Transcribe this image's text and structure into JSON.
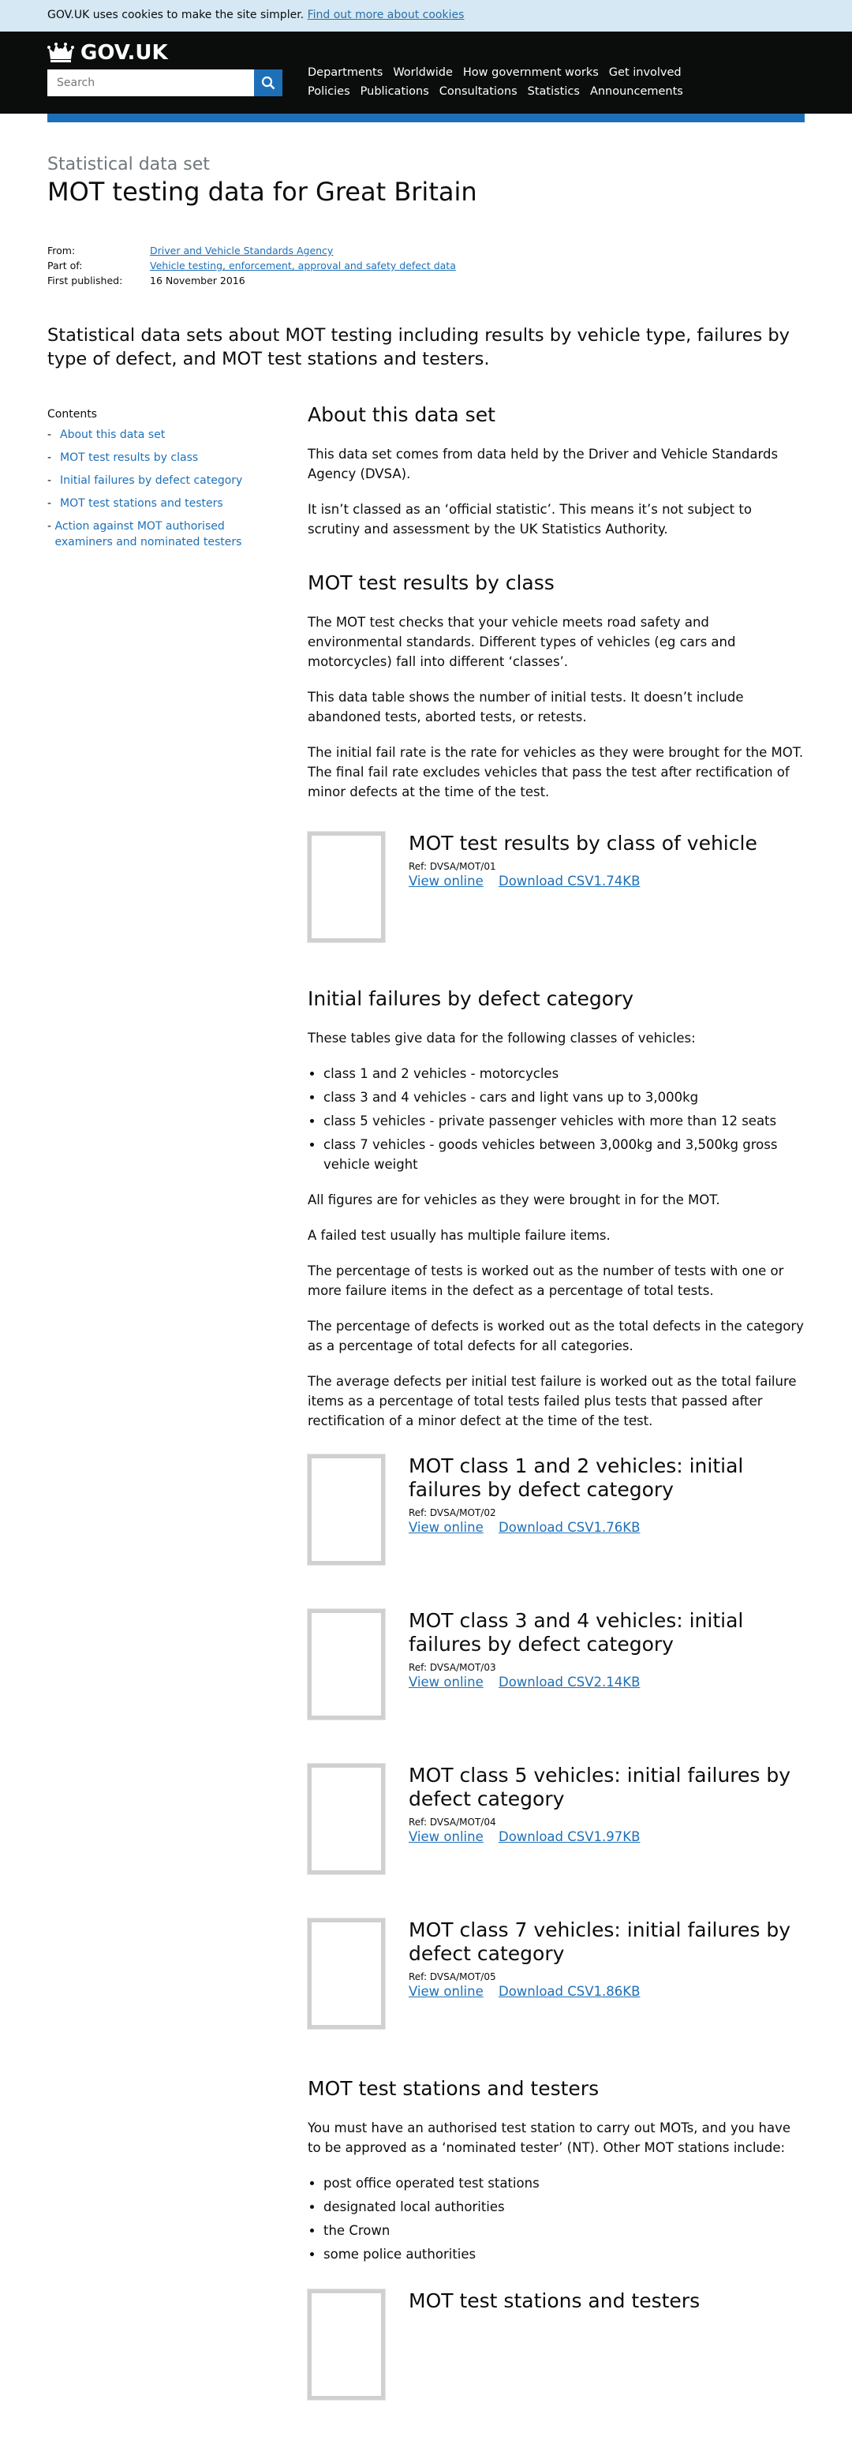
{
  "cookie_banner": {
    "text": "GOV.UK uses cookies to make the site simpler.",
    "link": "Find out more about cookies"
  },
  "header": {
    "logo": "GOV.UK",
    "search_placeholder": "Search",
    "nav_row1": [
      "Departments",
      "Worldwide",
      "How government works",
      "Get involved"
    ],
    "nav_row2": [
      "Policies",
      "Publications",
      "Consultations",
      "Statistics",
      "Announcements"
    ]
  },
  "page": {
    "doc_type": "Statistical data set",
    "title": "MOT testing data for Great Britain",
    "meta": {
      "from_label": "From:",
      "from_value": "Driver and Vehicle Standards Agency",
      "partof_label": "Part of:",
      "partof_value": "Vehicle testing, enforcement, approval and safety defect data",
      "published_label": "First published:",
      "published_value": "16 November 2016"
    },
    "summary": "Statistical data sets about MOT testing including results by vehicle type, failures by type of defect, and MOT test stations and testers."
  },
  "contents": {
    "title": "Contents",
    "items": [
      "About this data set",
      "MOT test results by class",
      "Initial failures by defect category",
      "MOT test stations and testers",
      "Action against MOT authorised examiners and nominated testers"
    ]
  },
  "sections": {
    "about": {
      "heading": "About this data set",
      "p1": "This data set comes from data held by the Driver and Vehicle Standards Agency (DVSA).",
      "p2": "It isn’t classed as an ‘official statistic’. This means it’s not subject to scrutiny and assessment by the UK Statistics Authority."
    },
    "results": {
      "heading": "MOT test results by class",
      "p1": "The MOT test checks that your vehicle meets road safety and environmental standards. Different types of vehicles (eg cars and motorcycles) fall into different ‘classes’.",
      "p2": "This data table shows the number of initial tests. It doesn’t include abandoned tests, aborted tests, or retests.",
      "p3": "The initial fail rate is the rate for vehicles as they were brought for the MOT. The final fail rate excludes vehicles that pass the test after rectification of minor defects at the time of the test."
    },
    "failures": {
      "heading": "Initial failures by defect category",
      "p1": "These tables give data for the following classes of vehicles:",
      "list": [
        "class 1 and 2 vehicles - motorcycles",
        "class 3 and 4 vehicles - cars and light vans up to 3,000kg",
        "class 5 vehicles - private passenger vehicles with more than 12 seats",
        "class 7 vehicles - goods vehicles between 3,000kg and 3,500kg gross vehicle weight"
      ],
      "p2": "All figures are for vehicles as they were brought in for the MOT.",
      "p3": "A failed test usually has multiple failure items.",
      "p4": "The percentage of tests is worked out as the number of tests with one or more failure items in the defect as a percentage of total tests.",
      "p5": "The percentage of defects is worked out as the total defects in the category as a percentage of total defects for all categories.",
      "p6": "The average defects per initial test failure is worked out as the total failure items as a percentage of total tests failed plus tests that passed after rectification of a minor defect at the time of the test."
    },
    "stations": {
      "heading": "MOT test stations and testers",
      "p1": "You must have an authorised test station to carry out MOTs, and you have to be approved as a ‘nominated tester’ (NT). Other MOT stations include:",
      "list": [
        "post office operated test stations",
        "designated local authorities",
        "the Crown",
        "some police authorities"
      ]
    }
  },
  "attachments": [
    {
      "title": "MOT test results by class of vehicle",
      "ref": "Ref: DVSA/MOT/01",
      "view": "View online",
      "download": "Download CSV1.74KB"
    },
    {
      "title": "MOT class 1 and 2 vehicles: initial failures by defect category",
      "ref": "Ref: DVSA/MOT/02",
      "view": "View online",
      "download": "Download CSV1.76KB"
    },
    {
      "title": "MOT class 3 and 4 vehicles: initial failures by defect category",
      "ref": "Ref: DVSA/MOT/03",
      "view": "View online",
      "download": "Download CSV2.14KB"
    },
    {
      "title": "MOT class 5 vehicles: initial failures by defect category",
      "ref": "Ref: DVSA/MOT/04",
      "view": "View online",
      "download": "Download CSV1.97KB"
    },
    {
      "title": "MOT class 7 vehicles: initial failures by defect category",
      "ref": "Ref: DVSA/MOT/05",
      "view": "View online",
      "download": "Download CSV1.86KB"
    },
    {
      "title": "MOT test stations and testers"
    }
  ],
  "colors": {
    "link": "#1d70b8",
    "header": "#0b0c0c",
    "cookie_bg": "#d5e8f3",
    "muted": "#6f777b"
  },
  "icons": {
    "search": "search-icon",
    "crown": "crown-icon"
  }
}
